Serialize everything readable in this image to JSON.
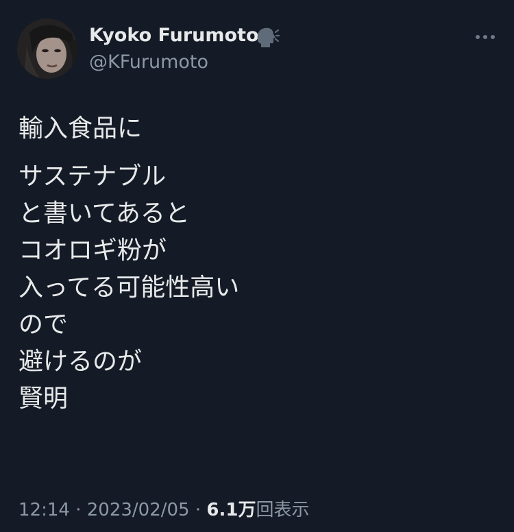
{
  "tweet": {
    "author": {
      "display_name": "Kyoko Furumoto",
      "handle": "@KFurumoto",
      "badge_icon": "speaking-head-icon"
    },
    "more_icon": "more-dots-icon",
    "lines": [
      "輸入食品に",
      "サステナブル",
      "と書いてあると",
      "コオロギ粉が",
      "入ってる可能性高い",
      "ので",
      "避けるのが",
      "賢明"
    ],
    "meta": {
      "time": "12:14",
      "separator1": " · ",
      "date": "2023/02/05",
      "separator2": " · ",
      "views_count": "6.1万",
      "views_label": "回表示"
    }
  },
  "colors": {
    "background": "#151b26",
    "text_primary": "#e7e9ea",
    "text_secondary": "#8b98a5"
  }
}
